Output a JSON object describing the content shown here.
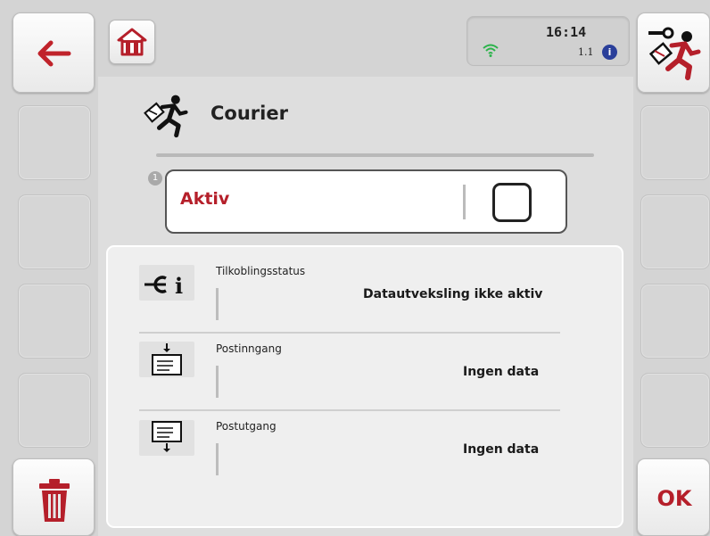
{
  "status": {
    "time": "16:14",
    "version": "1.1",
    "info_icon": "info-icon",
    "signal_icon": "wifi-icon"
  },
  "header": {
    "title": "Courier",
    "title_icon": "courier-runner-icon"
  },
  "aktiv": {
    "step_number": "1",
    "label": "Aktiv",
    "checked": false
  },
  "rows": [
    {
      "label": "Tilkoblingsstatus",
      "value": "Datautveksling ikke aktiv",
      "icon": "connection-info-icon"
    },
    {
      "label": "Postinngang",
      "value": "Ingen data",
      "icon": "inbox-icon"
    },
    {
      "label": "Postutgang",
      "value": "Ingen data",
      "icon": "outbox-icon"
    }
  ],
  "buttons": {
    "back_icon": "back-arrow-icon",
    "home_icon": "home-icon",
    "settings_icon": "courier-settings-icon",
    "delete_icon": "trash-icon",
    "ok_label": "OK"
  },
  "colors": {
    "accent_red": "#b51f2a",
    "wifi_green": "#2bb34a",
    "info_blue": "#2a3f9a"
  }
}
